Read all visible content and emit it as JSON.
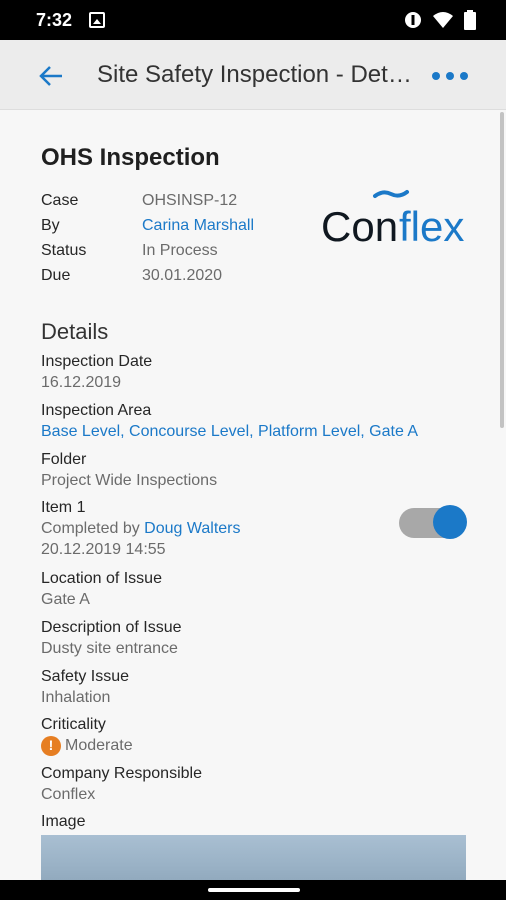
{
  "status_bar": {
    "time": "7:32"
  },
  "app_bar": {
    "title": "Site Safety Inspection - Details"
  },
  "header": {
    "title": "OHS Inspection",
    "summary": [
      {
        "label": "Case",
        "value": "OHSINSP-12"
      },
      {
        "label": "By",
        "value": "Carina Marshall"
      },
      {
        "label": "Status",
        "value": "In Process"
      },
      {
        "label": "Due",
        "value": "30.01.2020"
      }
    ],
    "logo_text": "Conflex"
  },
  "details": {
    "title": "Details",
    "inspection_date": {
      "label": "Inspection Date",
      "value": "16.12.2019"
    },
    "inspection_area": {
      "label": "Inspection Area",
      "value": "Base Level, Concourse Level, Platform Level, Gate A"
    },
    "folder": {
      "label": "Folder",
      "value": "Project Wide Inspections"
    },
    "item": {
      "label": "Item 1",
      "completed_prefix": "Completed by",
      "completed_by": "Doug Walters",
      "completed_at": "20.12.2019 14:55",
      "toggle_on": true
    },
    "location": {
      "label": "Location of Issue",
      "value": "Gate A"
    },
    "description": {
      "label": "Description of Issue",
      "value": "Dusty site entrance"
    },
    "safety_issue": {
      "label": "Safety Issue",
      "value": "Inhalation"
    },
    "criticality": {
      "label": "Criticality",
      "value": "Moderate",
      "icon": "warning-icon",
      "color": "#e67e22"
    },
    "company": {
      "label": "Company Responsible",
      "value": "Conflex"
    },
    "image": {
      "label": "Image"
    }
  },
  "colors": {
    "accent": "#1b79c8",
    "app_bar_bg": "#ececec",
    "page_bg": "#f7f7f7"
  }
}
